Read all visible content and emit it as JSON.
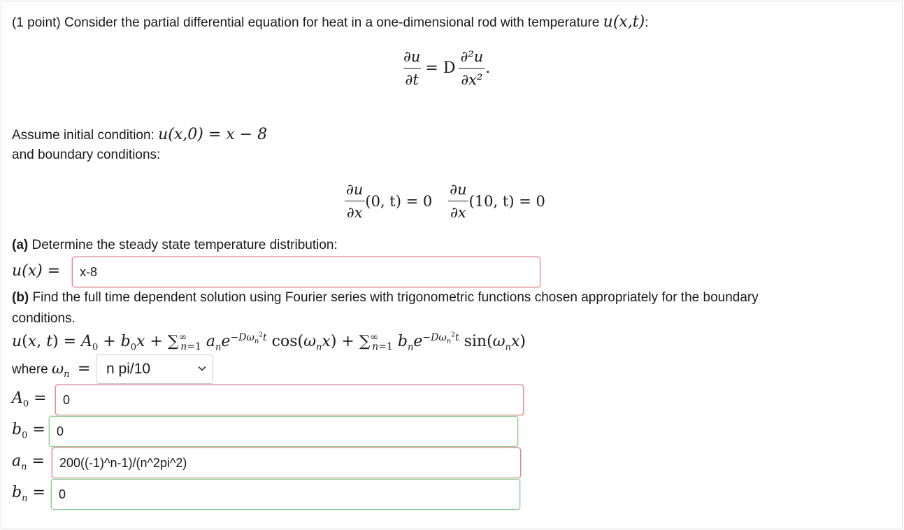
{
  "intro": "(1 point) Consider the partial differential equation for heat in a one-dimensional rod with temperature",
  "intro_var": "u(x,t)",
  "intro_colon": ":",
  "pde": {
    "lhs_num": "∂u",
    "lhs_den": "∂t",
    "eq": "= D",
    "rhs_num": "∂²u",
    "rhs_den": "∂x²",
    "end": "."
  },
  "initial": {
    "label": "Assume initial condition:",
    "math": "u(x,0) = x − 8"
  },
  "boundary": {
    "label": "and boundary conditions:",
    "left_num": "∂u",
    "left_den": "∂x",
    "left_rest": "(0, t) = 0",
    "right_num": "∂u",
    "right_den": "∂x",
    "right_rest": "(10, t) = 0"
  },
  "part_a": {
    "tag": "(a)",
    "text": "Determine the steady state temperature distribution:",
    "lhs": "u(x) =",
    "answer": "x-8"
  },
  "part_b": {
    "tag": "(b)",
    "text_line1": "Find the full time dependent solution using Fourier series with trigonometric functions chosen appropriately for the boundary",
    "text_line2": "conditions.",
    "where": "where",
    "omega": "ωn",
    "eq": "=",
    "select_value": "n pi/10"
  },
  "answers": {
    "A0_label": "A0",
    "A0_value": "0",
    "b0_label": "b0",
    "b0_value": "0",
    "an_label": "an",
    "an_value": "200((-1)^n-1)/(n^2pi^2)",
    "bn_label": "bn",
    "bn_value": "0"
  },
  "colors": {
    "error_border": "#d9888f",
    "correct_border": "#8cc98c"
  }
}
